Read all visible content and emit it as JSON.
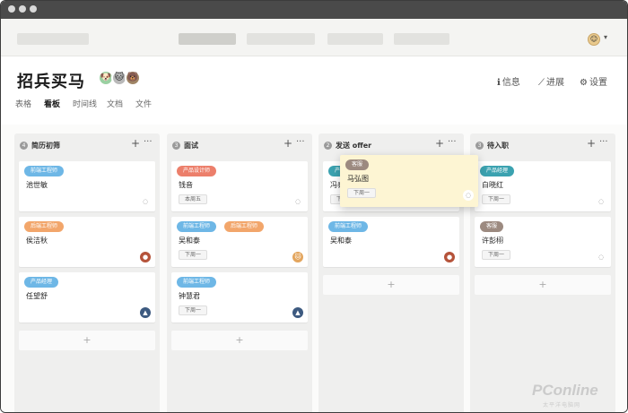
{
  "app": {
    "title": "招兵买马",
    "user_avatar_icon": "user-avatar-icon"
  },
  "header_actions": [
    {
      "icon": "info-icon",
      "glyph": "ℹ",
      "label": "信息"
    },
    {
      "icon": "chart-icon",
      "glyph": "📈",
      "label": "进展"
    },
    {
      "icon": "gear-icon",
      "glyph": "⚙",
      "label": "设置"
    }
  ],
  "view_tabs": [
    {
      "label": "表格",
      "active": false
    },
    {
      "label": "看板",
      "active": true
    },
    {
      "label": "时间线",
      "active": false
    },
    {
      "label": "文档",
      "active": false
    },
    {
      "label": "文件",
      "active": false
    }
  ],
  "members": [
    {
      "color": "#9bd0a2",
      "glyph": "🐶"
    },
    {
      "color": "#b9b9b9",
      "glyph": "🐱"
    },
    {
      "color": "#a08566",
      "glyph": "🐻"
    }
  ],
  "columns": [
    {
      "count": "4",
      "title": "简历初筛",
      "plus": "+",
      "more": "···",
      "cards": [
        {
          "tags": [
            {
              "text": "前端工程师",
              "color": "#6eb7e6"
            }
          ],
          "name": "池世敏",
          "time": "",
          "avatar_color": "#ffffff",
          "avatar_glyph": "◌"
        },
        {
          "tags": [
            {
              "text": "后端工程师",
              "color": "#f2a66b"
            }
          ],
          "name": "侯洁秋",
          "time": "",
          "avatar_color": "#b5533a",
          "avatar_glyph": "●"
        },
        {
          "tags": [
            {
              "text": "产品经理",
              "color": "#6eb7e6"
            }
          ],
          "name": "任望舒",
          "time": "",
          "avatar_color": "#3d5a80",
          "avatar_glyph": "▲"
        }
      ],
      "add": "+"
    },
    {
      "count": "3",
      "title": "面试",
      "plus": "+",
      "more": "···",
      "cards": [
        {
          "tags": [
            {
              "text": "产品设计师",
              "color": "#ec7f6b"
            }
          ],
          "name": "钱音",
          "time": "本周五",
          "avatar_color": "#ffffff",
          "avatar_glyph": "◌"
        },
        {
          "tags": [
            {
              "text": "前端工程师",
              "color": "#6eb7e6"
            },
            {
              "text": "后端工程师",
              "color": "#f2a66b"
            }
          ],
          "name": "吴和泰",
          "time": "下周一",
          "avatar_color": "#e3a55d",
          "avatar_glyph": "🐱"
        },
        {
          "tags": [
            {
              "text": "前端工程师",
              "color": "#6eb7e6"
            }
          ],
          "name": "钟慧君",
          "time": "下周一",
          "avatar_color": "#3d5a80",
          "avatar_glyph": "▲"
        }
      ],
      "add": "+"
    },
    {
      "count": "2",
      "title": "发送 offer",
      "plus": "+",
      "more": "···",
      "cards": [
        {
          "tags": [
            {
              "text": "产品经理",
              "color": "#3ba2b0"
            }
          ],
          "name": "冯泰清",
          "time": "下周一",
          "avatar_color": "#ffffff",
          "avatar_glyph": ""
        },
        {
          "tags": [
            {
              "text": "前端工程师",
              "color": "#6eb7e6"
            }
          ],
          "name": "吴和泰",
          "time": "",
          "avatar_color": "#b5533a",
          "avatar_glyph": "●"
        }
      ],
      "floating_card": {
        "tags": [
          {
            "text": "客服",
            "color": "#9c8a80"
          }
        ],
        "name": "马弘图",
        "time": "下周一",
        "avatar_color": "#ffffff",
        "avatar_glyph": "◌"
      },
      "add": "+"
    },
    {
      "count": "3",
      "title": "待入职",
      "plus": "+",
      "more": "···",
      "cards": [
        {
          "tags": [
            {
              "text": "产品经理",
              "color": "#3ba2b0"
            }
          ],
          "name": "白晓红",
          "time": "下周一",
          "avatar_color": "#ffffff",
          "avatar_glyph": "◌"
        },
        {
          "tags": [
            {
              "text": "客服",
              "color": "#9c8a80"
            }
          ],
          "name": "许彭栩",
          "time": "下周一",
          "avatar_color": "#ffffff",
          "avatar_glyph": "◌"
        }
      ],
      "add": "+"
    }
  ],
  "watermark": {
    "text": "PConline",
    "sub": "太平洋电脑网"
  }
}
